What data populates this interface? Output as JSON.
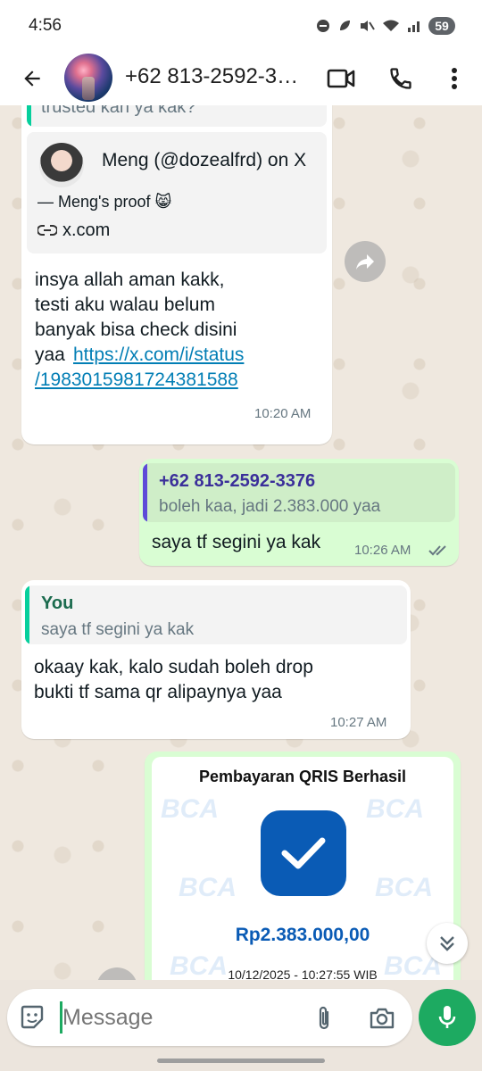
{
  "status_bar": {
    "time": "4:56",
    "battery": "59"
  },
  "header": {
    "contact_name": "+62 813-2592-3376",
    "icons": [
      "back-arrow-icon",
      "video-call-icon",
      "phone-icon",
      "more-vert-icon"
    ]
  },
  "messages": {
    "m1": {
      "quote_text": "trusted kan ya kak?",
      "preview_title": "Meng (@dozealfrd) on X",
      "preview_desc": "— Meng's proof 😸",
      "preview_domain": "x.com",
      "text_line1": "insya allah aman kakk,",
      "text_line2": "testi aku walau belum",
      "text_line3": "banyak bisa check disini",
      "text_line4_prefix": "yaa ",
      "link_part1": "https://x.com/i/status",
      "link_part2": "/1983015981724381588",
      "time": "10:20 AM"
    },
    "m2": {
      "quote_author": "+62 813-2592-3376",
      "quote_text": "boleh kaa, jadi 2.383.000 yaa",
      "text": "saya tf segini ya kak",
      "time": "10:26 AM"
    },
    "m3": {
      "quote_author": "You",
      "quote_text": "saya tf segini ya kak",
      "text_line1": "okaay kak, kalo sudah boleh drop",
      "text_line2": "bukti tf sama qr alipaynya yaa",
      "time": "10:27 AM"
    },
    "m4": {
      "receipt_title": "Pembayaran QRIS Berhasil",
      "amount": "Rp2.383.000,00",
      "datetime": "10/12/2025 - 10:27:55 WIB",
      "watermark": "BCA"
    }
  },
  "input": {
    "placeholder": "Message"
  },
  "colors": {
    "accent_green": "#1daa61",
    "out_bubble": "#d9fdd3",
    "quote_bar_green": "#06cf9c",
    "quote_bar_purple": "#5e4bd8",
    "link": "#027eb5",
    "bca_blue": "#0a5bb5"
  }
}
